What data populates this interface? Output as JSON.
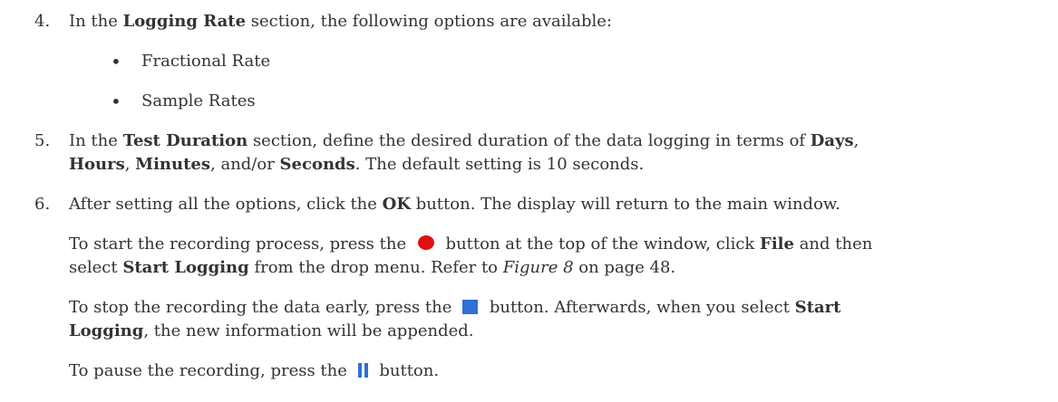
{
  "step4": {
    "number": "4.",
    "pre": "In the ",
    "bold": "Logging Rate",
    "post": " section, the following options are available:",
    "bullets": [
      "Fractional Rate",
      "Sample Rates"
    ]
  },
  "step5": {
    "number": "5.",
    "l1_pre": "In the ",
    "l1_bold1": "Test Duration",
    "l1_mid": " section, define the desired duration of the data logging in terms of ",
    "l1_bold2": "Days",
    "l1_end": ",",
    "l2_bold1": "Hours",
    "l2_sep1": ", ",
    "l2_bold2": "Minutes",
    "l2_sep2": ", and/or ",
    "l2_bold3": "Seconds",
    "l2_end": ". The default setting is 10 seconds."
  },
  "step6": {
    "number": "6.",
    "pre": "After setting all the options, click the ",
    "bold": "OK",
    "post": " button. The display will return to the main window."
  },
  "para_start": {
    "l1_pre": "To start the recording process,  press the ",
    "l1_post": " button at the top of the window, click ",
    "l1_bold": "File",
    "l1_end": " and then",
    "l2_pre": "select ",
    "l2_bold": "Start Logging",
    "l2_mid": " from the drop menu.  Refer to ",
    "l2_italic": "Figure 8",
    "l2_end": " on page 48."
  },
  "para_stop": {
    "l1_pre": "To stop the recording the data early,  press the ",
    "l1_post": " button. Afterwards, when you select ",
    "l1_bold": "Start",
    "l2_bold": "Logging",
    "l2_end": ", the new information will be appended."
  },
  "para_pause": {
    "pre": "To pause the recording, press the ",
    "post": " button."
  },
  "icons": {
    "record": {
      "name": "record-icon",
      "color": "#e01010"
    },
    "stop": {
      "name": "stop-icon",
      "color": "#2f6fd6"
    },
    "pause": {
      "name": "pause-icon",
      "color": "#2f6fd6"
    }
  }
}
